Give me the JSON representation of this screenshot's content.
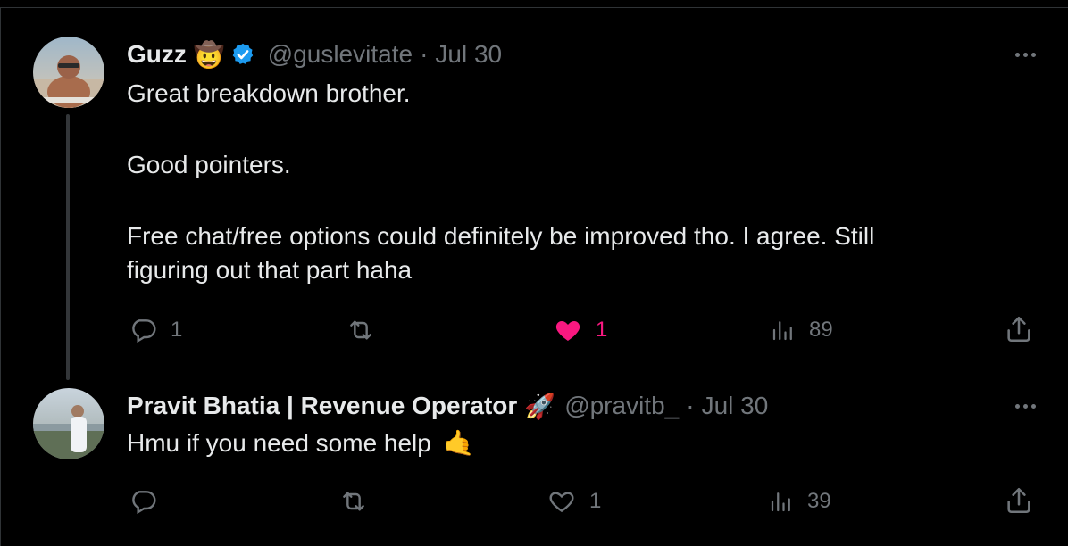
{
  "tweets": [
    {
      "name": "Guzz",
      "name_emoji": "🤠",
      "handle": "@guslevitate",
      "separator": "·",
      "date": "Jul 30",
      "lines": [
        "Great breakdown brother.",
        "Good pointers.",
        "Free chat/free options could definitely be improved tho. I agree. Still",
        "figuring out that part haha"
      ],
      "replies": "1",
      "likes": "1",
      "views": "89",
      "liked": true
    },
    {
      "name": "Pravit Bhatia | Revenue Operator",
      "name_emoji": "🚀",
      "handle": "@pravitb_",
      "separator": "·",
      "date": "Jul 30",
      "text": "Hmu if you need some help",
      "text_emoji": "🤙",
      "likes": "1",
      "views": "39",
      "liked": false
    }
  ],
  "colors": {
    "background": "#000000",
    "text": "#e7e9ea",
    "muted": "#71767b",
    "verified": "#1d9bf0",
    "like": "#f91880",
    "thread_line": "#333639"
  }
}
